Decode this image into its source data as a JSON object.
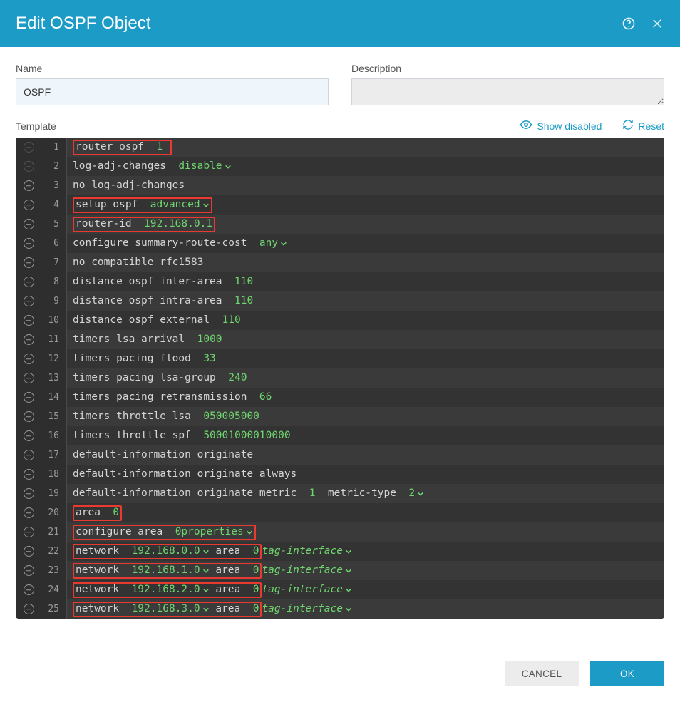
{
  "window": {
    "title": "Edit OSPF Object"
  },
  "form": {
    "name_label": "Name",
    "name_value": "OSPF",
    "desc_label": "Description",
    "desc_value": ""
  },
  "toolbar": {
    "template_label": "Template",
    "show_disabled": "Show disabled",
    "reset": "Reset"
  },
  "editor": {
    "lines": [
      {
        "n": 1,
        "dim": true,
        "indent": 0,
        "hl": true,
        "segs": [
          [
            "cmd",
            "router ospf "
          ],
          [
            "green",
            " 1 "
          ]
        ]
      },
      {
        "n": 2,
        "dim": true,
        "indent": 1,
        "hl": false,
        "segs": [
          [
            "cmd",
            "log-adj-changes  "
          ],
          [
            "green",
            "disable"
          ],
          [
            "caret",
            ""
          ]
        ]
      },
      {
        "n": 3,
        "dim": false,
        "indent": 2,
        "hl": false,
        "segs": [
          [
            "cmd",
            "no log-adj-changes"
          ]
        ]
      },
      {
        "n": 4,
        "dim": false,
        "indent": 1,
        "hl": true,
        "segs": [
          [
            "cmd",
            "setup ospf  "
          ],
          [
            "green",
            "advanced"
          ],
          [
            "caret",
            ""
          ]
        ]
      },
      {
        "n": 5,
        "dim": false,
        "indent": 2,
        "hl": true,
        "segs": [
          [
            "cmd",
            "router-id  "
          ],
          [
            "green",
            "192.168.0.1"
          ]
        ]
      },
      {
        "n": 6,
        "dim": false,
        "indent": 2,
        "hl": false,
        "segs": [
          [
            "cmd",
            "configure summary-route-cost  "
          ],
          [
            "green",
            "any"
          ],
          [
            "caret",
            ""
          ]
        ]
      },
      {
        "n": 7,
        "dim": false,
        "indent": 3,
        "hl": false,
        "segs": [
          [
            "cmd",
            "no compatible rfc1583"
          ]
        ]
      },
      {
        "n": 8,
        "dim": false,
        "indent": 2,
        "hl": false,
        "segs": [
          [
            "cmd",
            "distance ospf inter-area  "
          ],
          [
            "green",
            "110"
          ]
        ]
      },
      {
        "n": 9,
        "dim": false,
        "indent": 2,
        "hl": false,
        "segs": [
          [
            "cmd",
            "distance ospf intra-area  "
          ],
          [
            "green",
            "110"
          ]
        ]
      },
      {
        "n": 10,
        "dim": false,
        "indent": 2,
        "hl": false,
        "segs": [
          [
            "cmd",
            "distance ospf external  "
          ],
          [
            "green",
            "110"
          ]
        ]
      },
      {
        "n": 11,
        "dim": false,
        "indent": 2,
        "hl": false,
        "segs": [
          [
            "cmd",
            "timers lsa arrival  "
          ],
          [
            "green",
            "1000"
          ]
        ]
      },
      {
        "n": 12,
        "dim": false,
        "indent": 2,
        "hl": false,
        "segs": [
          [
            "cmd",
            "timers pacing flood  "
          ],
          [
            "green",
            "33"
          ]
        ]
      },
      {
        "n": 13,
        "dim": false,
        "indent": 2,
        "hl": false,
        "segs": [
          [
            "cmd",
            "timers pacing lsa-group  "
          ],
          [
            "green",
            "240"
          ]
        ]
      },
      {
        "n": 14,
        "dim": false,
        "indent": 2,
        "hl": false,
        "segs": [
          [
            "cmd",
            "timers pacing retransmission  "
          ],
          [
            "green",
            "66"
          ]
        ]
      },
      {
        "n": 15,
        "dim": false,
        "indent": 2,
        "hl": false,
        "segs": [
          [
            "cmd",
            "timers throttle lsa  "
          ],
          [
            "green",
            "0"
          ],
          [
            "cmd",
            "   "
          ],
          [
            "green",
            "5000"
          ],
          [
            "cmd",
            "   "
          ],
          [
            "green",
            "5000"
          ]
        ]
      },
      {
        "n": 16,
        "dim": false,
        "indent": 2,
        "hl": false,
        "segs": [
          [
            "cmd",
            "timers throttle spf  "
          ],
          [
            "green",
            "5000"
          ],
          [
            "cmd",
            "   "
          ],
          [
            "green",
            "10000"
          ],
          [
            "cmd",
            "   "
          ],
          [
            "green",
            "10000"
          ]
        ]
      },
      {
        "n": 17,
        "dim": false,
        "indent": 2,
        "hl": false,
        "segs": [
          [
            "cmd",
            "default-information originate"
          ]
        ]
      },
      {
        "n": 18,
        "dim": false,
        "indent": 3,
        "hl": false,
        "segs": [
          [
            "cmd",
            "default-information originate always"
          ]
        ]
      },
      {
        "n": 19,
        "dim": false,
        "indent": 3,
        "hl": false,
        "segs": [
          [
            "cmd",
            "default-information originate metric  "
          ],
          [
            "green",
            "1"
          ],
          [
            "cmd",
            "  metric-type  "
          ],
          [
            "green",
            "2"
          ],
          [
            "caret",
            ""
          ]
        ]
      },
      {
        "n": 20,
        "dim": false,
        "indent": 1,
        "hl": true,
        "segs": [
          [
            "cmd",
            "area  "
          ],
          [
            "green",
            "0"
          ]
        ]
      },
      {
        "n": 21,
        "dim": false,
        "indent": 1,
        "hl": true,
        "segs": [
          [
            "cmd",
            "configure area  "
          ],
          [
            "green",
            "0"
          ],
          [
            "cmd",
            "   "
          ],
          [
            "green",
            "properties"
          ],
          [
            "caret",
            ""
          ]
        ]
      },
      {
        "n": 22,
        "dim": false,
        "indent": 2,
        "hl": true,
        "segs": [
          [
            "cmd",
            "network  "
          ],
          [
            "green",
            "192.168.0.0"
          ],
          [
            "caret",
            ""
          ],
          [
            "cmd",
            " area  "
          ],
          [
            "green",
            "0"
          ]
        ],
        "tail": "tag-interface"
      },
      {
        "n": 23,
        "dim": false,
        "indent": 2,
        "hl": true,
        "segs": [
          [
            "cmd",
            "network  "
          ],
          [
            "green",
            "192.168.1.0"
          ],
          [
            "caret",
            ""
          ],
          [
            "cmd",
            " area  "
          ],
          [
            "green",
            "0"
          ]
        ],
        "tail": "tag-interface"
      },
      {
        "n": 24,
        "dim": false,
        "indent": 2,
        "hl": true,
        "segs": [
          [
            "cmd",
            "network  "
          ],
          [
            "green",
            "192.168.2.0"
          ],
          [
            "caret",
            ""
          ],
          [
            "cmd",
            " area  "
          ],
          [
            "green",
            "0"
          ]
        ],
        "tail": "tag-interface"
      },
      {
        "n": 25,
        "dim": false,
        "indent": 2,
        "hl": true,
        "segs": [
          [
            "cmd",
            "network  "
          ],
          [
            "green",
            "192.168.3.0"
          ],
          [
            "caret",
            ""
          ],
          [
            "cmd",
            " area  "
          ],
          [
            "green",
            "0"
          ]
        ],
        "tail": "tag-interface"
      }
    ]
  },
  "footer": {
    "cancel": "CANCEL",
    "ok": "OK"
  }
}
